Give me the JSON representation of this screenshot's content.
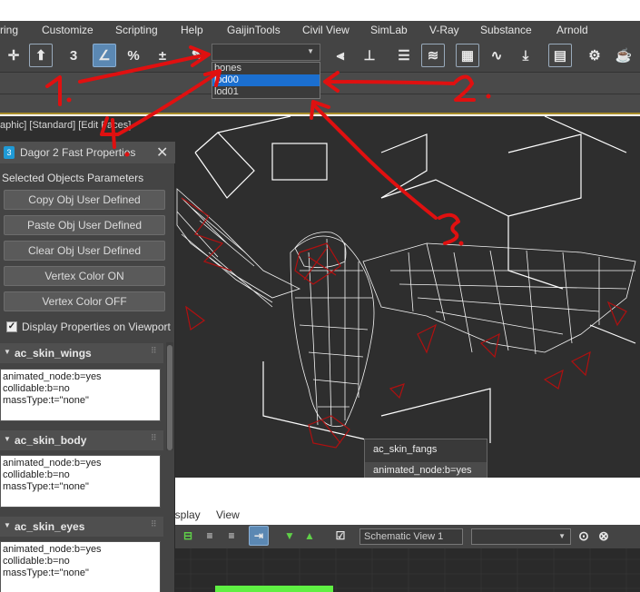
{
  "menubar": {
    "items": [
      "ring",
      "Customize",
      "Scripting",
      "Help",
      "GaijinTools",
      "Civil View",
      "SimLab",
      "V-Ray",
      "Substance",
      "Arnold"
    ]
  },
  "toolbar": {
    "selection_set": {
      "value": "",
      "options": [
        "bones",
        "lod00",
        "lod01"
      ],
      "highlighted": "lod00"
    }
  },
  "viewport": {
    "label": "aphic] [Standard] [Edit Faces]",
    "tooltip": {
      "title": "ac_skin_fangs",
      "value": "animated_node:b=yes"
    }
  },
  "panel": {
    "title": "Dagor 2 Fast Properties",
    "section": "Selected Objects Parameters",
    "buttons": [
      "Copy Obj User Defined",
      "Paste Obj User Defined",
      "Clear Obj User Defined",
      "Vertex Color ON",
      "Vertex Color OFF"
    ],
    "checkbox": {
      "label": "Display Properties on Viewport",
      "checked": true
    },
    "rollouts": [
      {
        "name": "ac_skin_wings",
        "props": [
          "animated_node:b=yes",
          "collidable:b=no",
          "massType:t=\"none\""
        ]
      },
      {
        "name": "ac_skin_body",
        "props": [
          "animated_node:b=yes",
          "collidable:b=no",
          "massType:t=\"none\""
        ]
      },
      {
        "name": "ac_skin_eyes",
        "props": [
          "animated_node:b=yes",
          "collidable:b=no",
          "massType:t=\"none\""
        ]
      }
    ]
  },
  "schematic": {
    "menu": [
      "isplay",
      "View"
    ],
    "view_name": "Schematic View 1"
  },
  "annotations": {
    "labels": [
      "1.",
      "2.",
      "3.",
      "4."
    ],
    "color": "#e01010"
  }
}
